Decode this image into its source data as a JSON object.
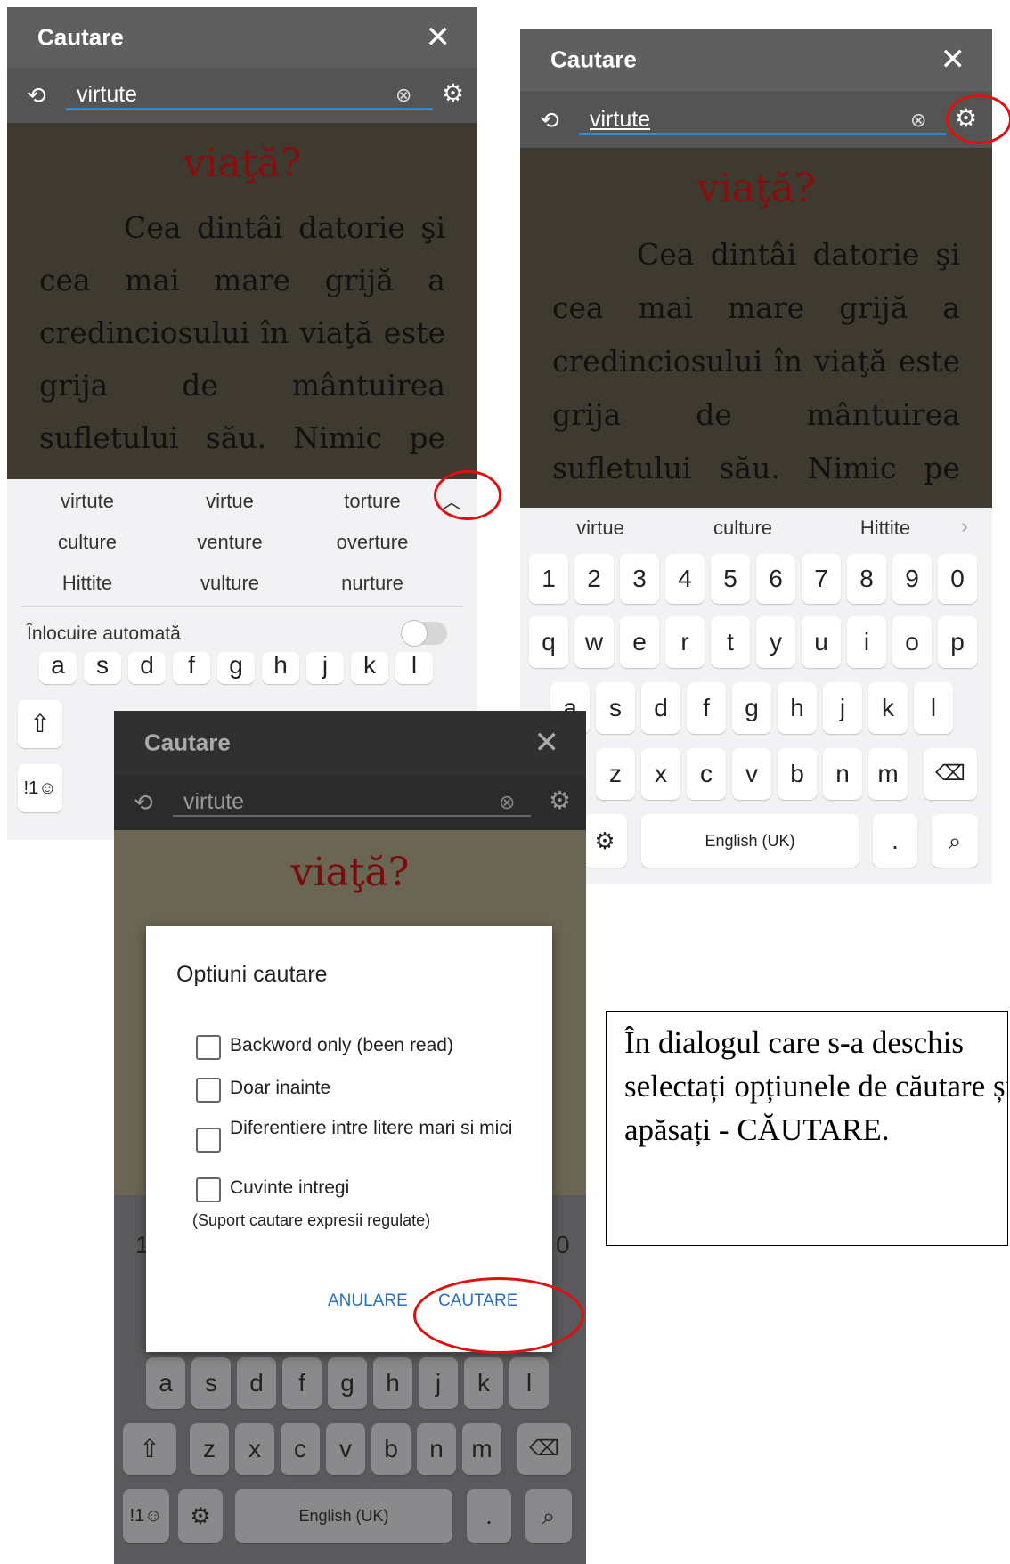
{
  "screen1": {
    "title": "Cautare",
    "query": "virtute",
    "heading": "viaţă?",
    "paragraph": "Cea dintâi datorie şi cea mai mare grijă a credinciosului în viaţă este grija de mântuirea sufletului său. Nimic pe",
    "suggestions": [
      "virtute",
      "virtue",
      "torture",
      "culture",
      "venture",
      "overture",
      "Hittite",
      "vulture",
      "nurture"
    ],
    "autoreplace_label": "Înlocuire automată",
    "autoreplace_on": false,
    "partial_keys": [
      "a",
      "s",
      "d",
      "f",
      "g",
      "h",
      "j",
      "k",
      "l"
    ],
    "bottom_keys": [
      "!1☺"
    ]
  },
  "screen2": {
    "title": "Cautare",
    "query": "virtute",
    "heading": "viaţă?",
    "paragraph": "Cea dintâi datorie şi cea mai mare grijă a credinciosului în viaţă este grija de mântuirea sufletului său. Nimic pe",
    "suggestions": [
      "virtue",
      "culture",
      "Hittite"
    ],
    "row_numbers": [
      "1",
      "2",
      "3",
      "4",
      "5",
      "6",
      "7",
      "8",
      "9",
      "0"
    ],
    "row_q": [
      "q",
      "w",
      "e",
      "r",
      "t",
      "y",
      "u",
      "i",
      "o",
      "p"
    ],
    "row_a": [
      "a",
      "s",
      "d",
      "f",
      "g",
      "h",
      "j",
      "k",
      "l"
    ],
    "row_z": [
      "z",
      "x",
      "c",
      "v",
      "b",
      "n",
      "m"
    ],
    "space_label": "English (UK)",
    "period": "."
  },
  "screen3": {
    "title": "Cautare",
    "query": "virtute",
    "heading": "viaţă?",
    "dialog": {
      "title": "Optiuni cautare",
      "options": [
        {
          "label": "Backword only (been read)",
          "checked": false
        },
        {
          "label": "Doar inainte",
          "checked": false
        },
        {
          "label": "Diferentiere intre litere mari si mici",
          "checked": false
        },
        {
          "label": "Cuvinte intregi",
          "checked": false
        }
      ],
      "note": "(Suport cautare expresii regulate)",
      "cancel": "ANULARE",
      "ok": "CAUTARE"
    },
    "row_a": [
      "a",
      "s",
      "d",
      "f",
      "g",
      "h",
      "j",
      "k",
      "l"
    ],
    "row_z": [
      "z",
      "x",
      "c",
      "v",
      "b",
      "n",
      "m"
    ],
    "sym_key": "!1☺",
    "space_label": "English (UK)",
    "period": ".",
    "side_digit_left": "1",
    "side_digit_right": "0"
  },
  "caption": "În dialogul care s-a deschis selectați opțiunele de căutare și apăsați - CĂUTARE.",
  "colors": {
    "accent": "#2a8ad8",
    "dialog_button": "#2a6ec4",
    "highlight": "#e01010"
  }
}
